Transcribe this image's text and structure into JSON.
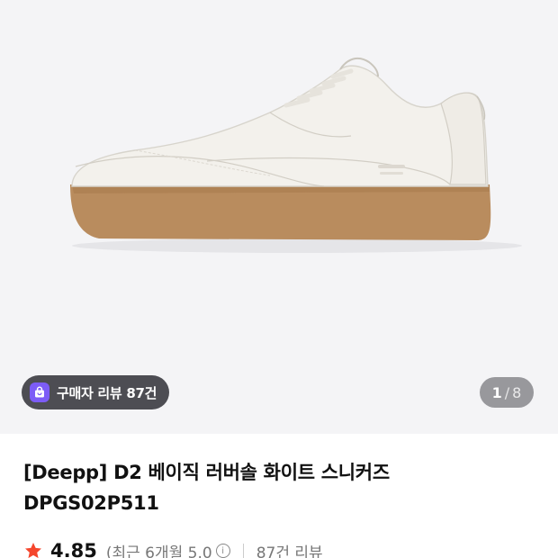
{
  "product": {
    "image_alt": "white leather sneaker with gum rubber sole",
    "review_badge_label": "구매자 리뷰 87건",
    "carousel": {
      "current": "1",
      "separator": "/",
      "total": "8"
    },
    "title_line1": "[Deepp] D2 베이직 러버솔 화이트 스니커즈",
    "title_line2": "DPGS02P511",
    "rating": {
      "value": "4.85",
      "recent_label": "(최근 6개월 5.0",
      "info_glyph": "i",
      "review_count": "87건 리뷰"
    }
  },
  "colors": {
    "star": "#f5462d",
    "badge": "#7c5cf6",
    "hero_bg": "#f4f4f6"
  },
  "icons": [
    "shopping-bag-icon",
    "star-icon",
    "info-icon"
  ]
}
